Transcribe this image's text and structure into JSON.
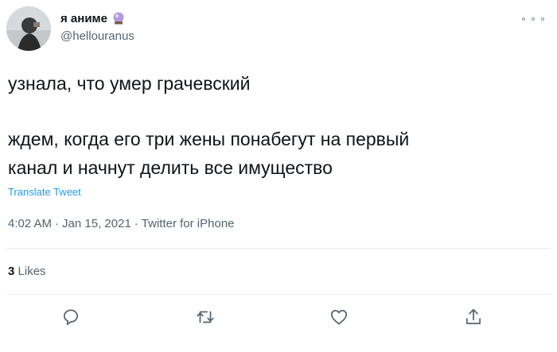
{
  "author": {
    "display_name": "я аниме",
    "handle": "@hellouranus",
    "emoji": "crystal-ball-icon"
  },
  "tweet": {
    "lines": [
      "узнала, что умер грачевский",
      "ждем, когда его три жены понабегут на первый",
      "канал и начнут делить все имущество"
    ],
    "translate_label": "Translate Tweet",
    "time": "4:02 AM",
    "date": "Jan 15, 2021",
    "source": "Twitter for iPhone"
  },
  "stats": {
    "likes_count": "3",
    "likes_label": "Likes"
  },
  "actions": {
    "reply": "reply-icon",
    "retweet": "retweet-icon",
    "like": "heart-icon",
    "share": "share-icon"
  },
  "colors": {
    "link": "#1d9bf0",
    "secondary_text": "#536471",
    "primary_text": "#0f1419",
    "divider": "#e6e9eb"
  }
}
